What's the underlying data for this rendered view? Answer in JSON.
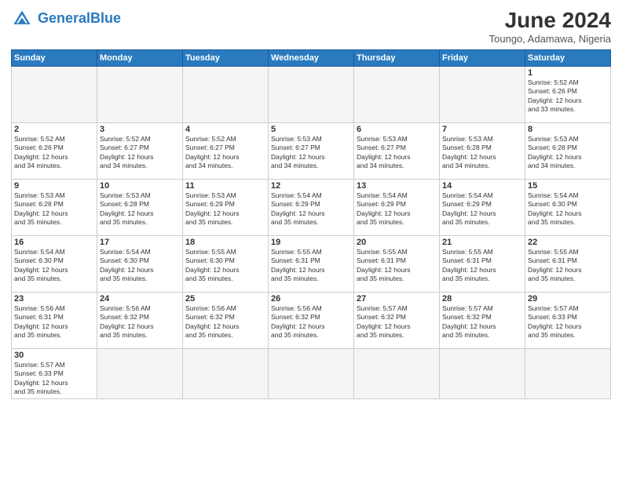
{
  "header": {
    "logo_general": "General",
    "logo_blue": "Blue",
    "month_title": "June 2024",
    "subtitle": "Toungo, Adamawa, Nigeria"
  },
  "weekdays": [
    "Sunday",
    "Monday",
    "Tuesday",
    "Wednesday",
    "Thursday",
    "Friday",
    "Saturday"
  ],
  "days": {
    "d1": {
      "n": "1",
      "info": "Sunrise: 5:52 AM\nSunset: 6:26 PM\nDaylight: 12 hours\nand 33 minutes."
    },
    "d2": {
      "n": "2",
      "info": "Sunrise: 5:52 AM\nSunset: 6:26 PM\nDaylight: 12 hours\nand 34 minutes."
    },
    "d3": {
      "n": "3",
      "info": "Sunrise: 5:52 AM\nSunset: 6:27 PM\nDaylight: 12 hours\nand 34 minutes."
    },
    "d4": {
      "n": "4",
      "info": "Sunrise: 5:52 AM\nSunset: 6:27 PM\nDaylight: 12 hours\nand 34 minutes."
    },
    "d5": {
      "n": "5",
      "info": "Sunrise: 5:53 AM\nSunset: 6:27 PM\nDaylight: 12 hours\nand 34 minutes."
    },
    "d6": {
      "n": "6",
      "info": "Sunrise: 5:53 AM\nSunset: 6:27 PM\nDaylight: 12 hours\nand 34 minutes."
    },
    "d7": {
      "n": "7",
      "info": "Sunrise: 5:53 AM\nSunset: 6:28 PM\nDaylight: 12 hours\nand 34 minutes."
    },
    "d8": {
      "n": "8",
      "info": "Sunrise: 5:53 AM\nSunset: 6:28 PM\nDaylight: 12 hours\nand 34 minutes."
    },
    "d9": {
      "n": "9",
      "info": "Sunrise: 5:53 AM\nSunset: 6:28 PM\nDaylight: 12 hours\nand 35 minutes."
    },
    "d10": {
      "n": "10",
      "info": "Sunrise: 5:53 AM\nSunset: 6:28 PM\nDaylight: 12 hours\nand 35 minutes."
    },
    "d11": {
      "n": "11",
      "info": "Sunrise: 5:53 AM\nSunset: 6:29 PM\nDaylight: 12 hours\nand 35 minutes."
    },
    "d12": {
      "n": "12",
      "info": "Sunrise: 5:54 AM\nSunset: 6:29 PM\nDaylight: 12 hours\nand 35 minutes."
    },
    "d13": {
      "n": "13",
      "info": "Sunrise: 5:54 AM\nSunset: 6:29 PM\nDaylight: 12 hours\nand 35 minutes."
    },
    "d14": {
      "n": "14",
      "info": "Sunrise: 5:54 AM\nSunset: 6:29 PM\nDaylight: 12 hours\nand 35 minutes."
    },
    "d15": {
      "n": "15",
      "info": "Sunrise: 5:54 AM\nSunset: 6:30 PM\nDaylight: 12 hours\nand 35 minutes."
    },
    "d16": {
      "n": "16",
      "info": "Sunrise: 5:54 AM\nSunset: 6:30 PM\nDaylight: 12 hours\nand 35 minutes."
    },
    "d17": {
      "n": "17",
      "info": "Sunrise: 5:54 AM\nSunset: 6:30 PM\nDaylight: 12 hours\nand 35 minutes."
    },
    "d18": {
      "n": "18",
      "info": "Sunrise: 5:55 AM\nSunset: 6:30 PM\nDaylight: 12 hours\nand 35 minutes."
    },
    "d19": {
      "n": "19",
      "info": "Sunrise: 5:55 AM\nSunset: 6:31 PM\nDaylight: 12 hours\nand 35 minutes."
    },
    "d20": {
      "n": "20",
      "info": "Sunrise: 5:55 AM\nSunset: 6:31 PM\nDaylight: 12 hours\nand 35 minutes."
    },
    "d21": {
      "n": "21",
      "info": "Sunrise: 5:55 AM\nSunset: 6:31 PM\nDaylight: 12 hours\nand 35 minutes."
    },
    "d22": {
      "n": "22",
      "info": "Sunrise: 5:55 AM\nSunset: 6:31 PM\nDaylight: 12 hours\nand 35 minutes."
    },
    "d23": {
      "n": "23",
      "info": "Sunrise: 5:56 AM\nSunset: 6:31 PM\nDaylight: 12 hours\nand 35 minutes."
    },
    "d24": {
      "n": "24",
      "info": "Sunrise: 5:56 AM\nSunset: 6:32 PM\nDaylight: 12 hours\nand 35 minutes."
    },
    "d25": {
      "n": "25",
      "info": "Sunrise: 5:56 AM\nSunset: 6:32 PM\nDaylight: 12 hours\nand 35 minutes."
    },
    "d26": {
      "n": "26",
      "info": "Sunrise: 5:56 AM\nSunset: 6:32 PM\nDaylight: 12 hours\nand 35 minutes."
    },
    "d27": {
      "n": "27",
      "info": "Sunrise: 5:57 AM\nSunset: 6:32 PM\nDaylight: 12 hours\nand 35 minutes."
    },
    "d28": {
      "n": "28",
      "info": "Sunrise: 5:57 AM\nSunset: 6:32 PM\nDaylight: 12 hours\nand 35 minutes."
    },
    "d29": {
      "n": "29",
      "info": "Sunrise: 5:57 AM\nSunset: 6:33 PM\nDaylight: 12 hours\nand 35 minutes."
    },
    "d30": {
      "n": "30",
      "info": "Sunrise: 5:57 AM\nSunset: 6:33 PM\nDaylight: 12 hours\nand 35 minutes."
    }
  }
}
